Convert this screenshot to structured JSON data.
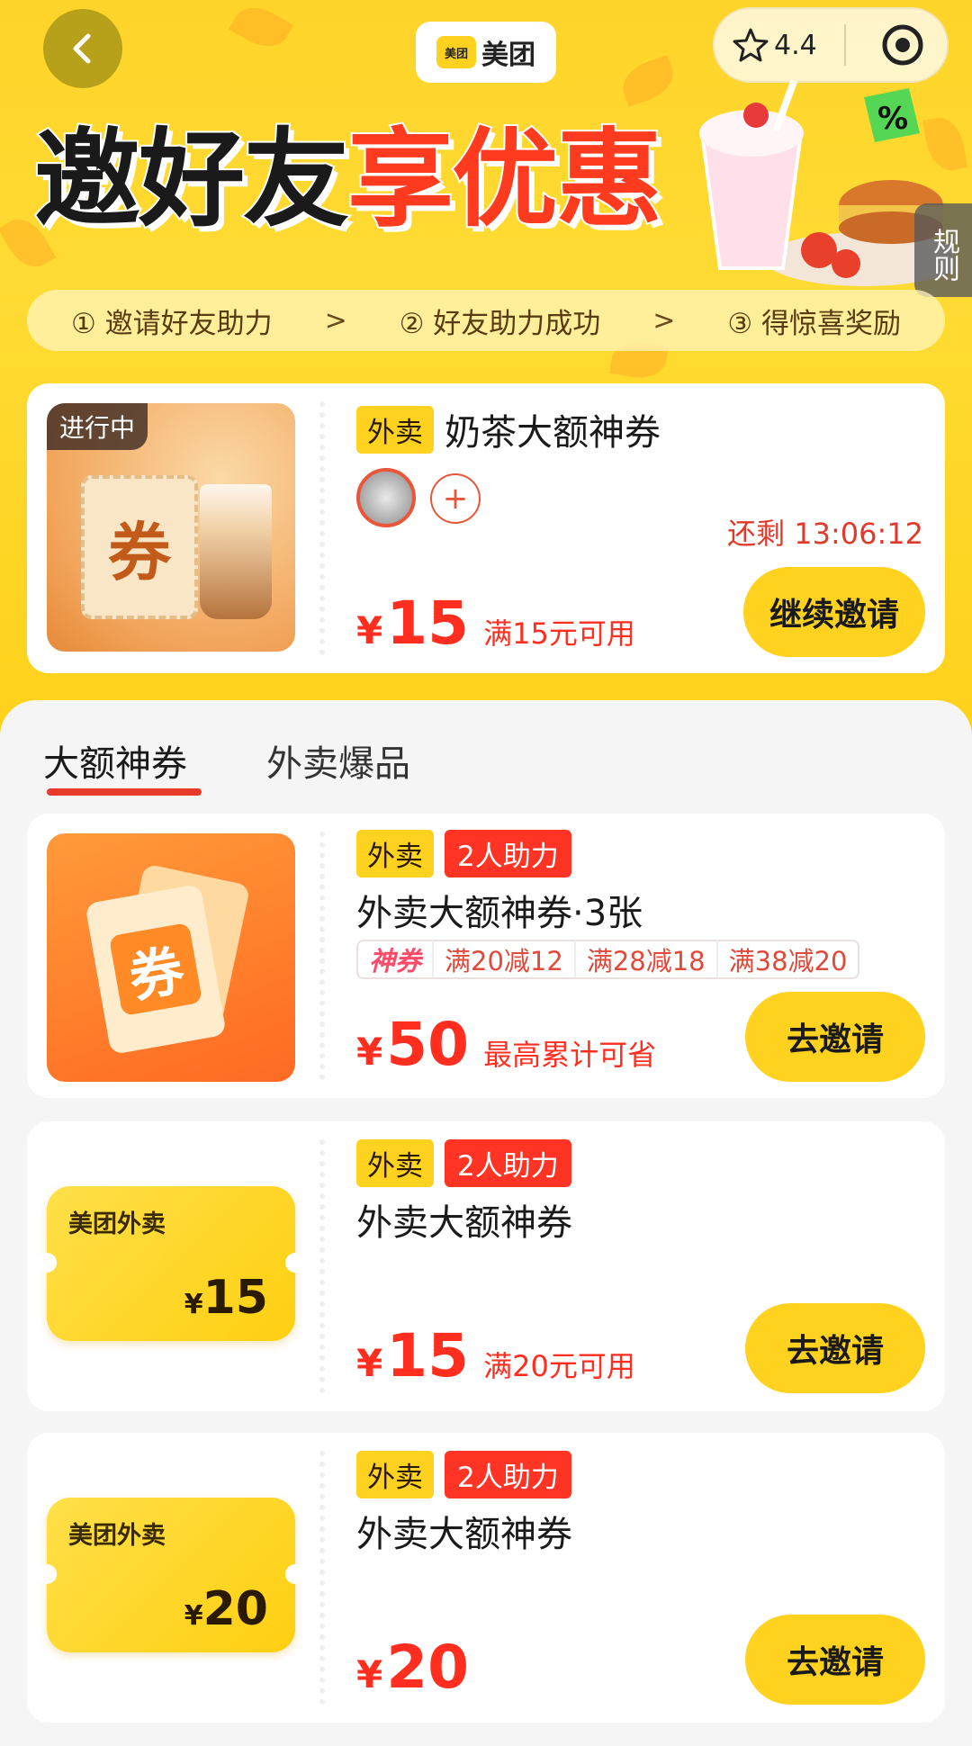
{
  "topbar": {
    "brand_mark": "美团",
    "brand_name": "美团",
    "rating": "4.4"
  },
  "hero": {
    "headline_dark": "邀好友",
    "headline_red": "享优惠",
    "rules_label": "规则",
    "steps": [
      {
        "label": "① 邀请好友助力"
      },
      {
        "label": "② 好友助力成功"
      },
      {
        "label": "③ 得惊喜奖励"
      }
    ],
    "step_arrow": ">"
  },
  "active": {
    "status": "进行中",
    "thumb_text": "券",
    "tag": "外卖",
    "title": "奶茶大额神券",
    "add_symbol": "+",
    "countdown": "还剩 13:06:12",
    "currency": "¥",
    "amount": "15",
    "condition": "满15元可用",
    "button": "继续邀请"
  },
  "tabs": [
    {
      "label": "大额神券",
      "active": true
    },
    {
      "label": "外卖爆品",
      "active": false
    }
  ],
  "items": [
    {
      "thumb_text": "券",
      "tag": "外卖",
      "badge": "2人助力",
      "title": "外卖大额神券·3张",
      "chips": [
        "神券",
        "满20减12",
        "满28减18",
        "满38减20"
      ],
      "currency": "¥",
      "amount": "50",
      "condition": "最高累计可省",
      "button": "去邀请"
    },
    {
      "coupon_brand": "美团外卖",
      "coupon_currency": "¥",
      "coupon_amount": "15",
      "tag": "外卖",
      "badge": "2人助力",
      "title": "外卖大额神券",
      "currency": "¥",
      "amount": "15",
      "condition": "满20元可用",
      "button": "去邀请"
    },
    {
      "coupon_brand": "美团外卖",
      "coupon_currency": "¥",
      "coupon_amount": "20",
      "tag": "外卖",
      "badge": "2人助力",
      "title": "外卖大额神券",
      "currency": "¥",
      "amount": "20",
      "condition": "",
      "button": "去邀请"
    }
  ],
  "colors": {
    "brand_yellow": "#ffd21f",
    "accent_red": "#ff2e1f"
  }
}
